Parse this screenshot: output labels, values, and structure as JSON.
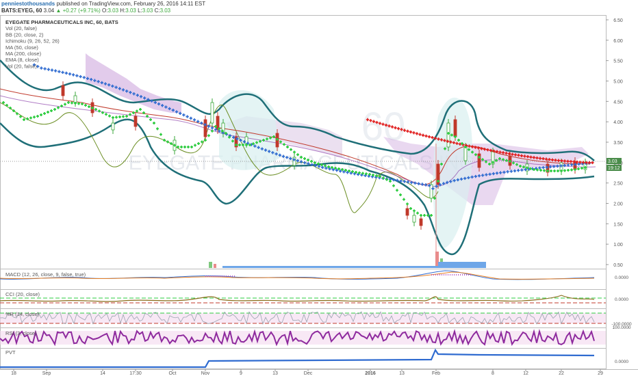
{
  "header": {
    "username": "penniestothousands",
    "published_text": "published on TradingView.com, February 26, 2016 14:11 EST",
    "symbol": "BATS:EYEG, 60",
    "last": "3.04",
    "change": "+0.27 (+9.71%)",
    "o_label": "O:",
    "o": "3.03",
    "h_label": "H:",
    "h": "3.03",
    "l_label": "L:",
    "l": "3.03",
    "c_label": "C:",
    "c": "3.03"
  },
  "legend": [
    "EYEGATE PHARMACEUTICALS INC, 60, BATS",
    "Vol (20, false)",
    "BB (20, close, 2)",
    "Ichimoku (9, 26, 52, 26)",
    "MA (50, close)",
    "MA (200, close)",
    "EMA (8, close)",
    "Vol (20, false)"
  ],
  "watermark": "EYEGATE PHARMACEUTICALS INC",
  "price_axis": [
    "6.50",
    "6.00",
    "5.50",
    "5.00",
    "4.50",
    "4.00",
    "3.50",
    "3.00",
    "2.50",
    "2.00",
    "1.50",
    "1.00",
    "0.50"
  ],
  "last_price_tag": "3.03",
  "countdown_tag": "19:12",
  "panes": [
    {
      "label": "MACD (12, 26, close, 9, false, true)",
      "axis": "0.0000"
    },
    {
      "label": "CCI (20, close)",
      "axis": "0.0000"
    },
    {
      "label": "%R (14, close)",
      "axis": "-100.0000"
    },
    {
      "label": "RSI (3, close)",
      "axis": "100.0000"
    },
    {
      "label": "PVT",
      "axis": "0.0000"
    }
  ],
  "time_axis": [
    "18",
    "Sep",
    "14",
    "17:30",
    "Oct",
    "Nov",
    "9",
    "13",
    "Dec",
    "2016",
    "13",
    "Feb",
    "8",
    "12",
    "22",
    "29"
  ],
  "colors": {
    "bb": "#1f6f78",
    "ma50": "#e01b1b",
    "ma200": "#2f6bd0",
    "ema8": "#2ecc40",
    "cloud": "#c9a8d8",
    "up_candle": "#3aa73a",
    "down_candle": "#c0392b",
    "last_tag": "#4a8c4a"
  },
  "chart_data": {
    "type": "line",
    "title": "EYEGATE PHARMACEUTICALS INC, 60, BATS",
    "ylim": [
      0.3,
      6.6
    ],
    "y_ticks": [
      6.5,
      6.0,
      5.5,
      5.0,
      4.5,
      4.0,
      3.5,
      3.0,
      2.5,
      2.0,
      1.5,
      1.0,
      0.5
    ],
    "x": [
      "18",
      "Sep",
      "14",
      "17:30",
      "Oct",
      "Nov",
      "9",
      "13",
      "Dec",
      "2016",
      "13",
      "Feb",
      "8",
      "12",
      "22",
      "29"
    ],
    "series": [
      {
        "name": "BB (20, close, 2)",
        "values": [
          5.0,
          4.7,
          4.4,
          4.2,
          3.6,
          4.5,
          4.3,
          3.9,
          2.6,
          2.5,
          2.6,
          3.1,
          4.3,
          3.4,
          3.2,
          3.0
        ]
      },
      {
        "name": "MA (50, close)",
        "values": [
          4.7,
          4.5,
          4.2,
          4.0,
          3.8,
          3.7,
          3.5,
          3.3,
          3.1,
          2.9,
          2.8,
          2.5,
          2.6,
          2.8,
          2.9,
          3.0
        ]
      },
      {
        "name": "MA (200, close)",
        "values": [
          null,
          null,
          null,
          null,
          null,
          null,
          null,
          null,
          null,
          4.05,
          3.8,
          3.4,
          3.3,
          3.2,
          3.1,
          3.0
        ]
      },
      {
        "name": "EMA (8, close)",
        "values": [
          4.6,
          4.4,
          4.2,
          3.8,
          3.4,
          3.5,
          3.3,
          3.4,
          2.8,
          2.7,
          2.5,
          1.7,
          3.1,
          3.0,
          2.8,
          2.9
        ]
      }
    ],
    "last_price": 3.03
  }
}
